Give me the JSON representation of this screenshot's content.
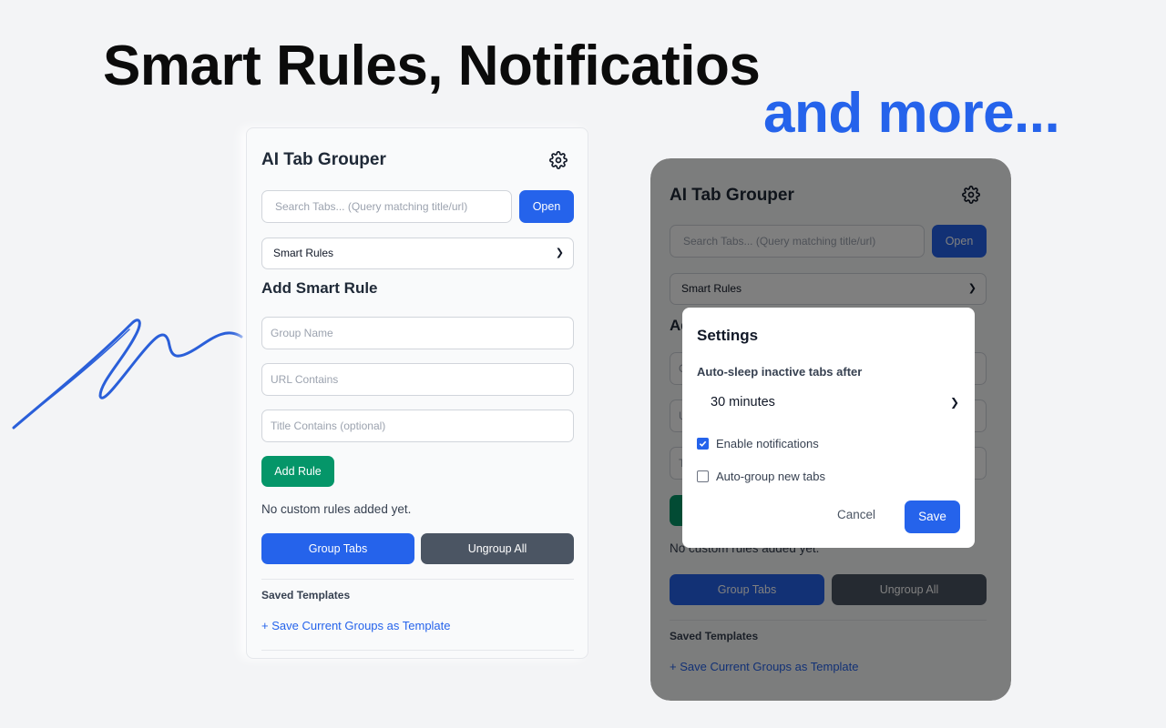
{
  "headline": "Smart Rules, Notificatios",
  "subheadline": "and more...",
  "popup": {
    "app_title": "AI Tab Grouper",
    "search_placeholder": "Search Tabs... (Query matching title/url)",
    "open_label": "Open",
    "mode_select": "Smart Rules",
    "add_rule_heading": "Add Smart Rule",
    "group_name_placeholder": "Group Name",
    "url_contains_placeholder": "URL Contains",
    "title_contains_placeholder": "Title Contains (optional)",
    "add_rule_label": "Add Rule",
    "empty_rules_text": "No custom rules added yet.",
    "group_tabs_label": "Group Tabs",
    "ungroup_all_label": "Ungroup All",
    "saved_templates_label": "Saved Templates",
    "save_template_link": "+ Save Current Groups as Template"
  },
  "settings_modal": {
    "title": "Settings",
    "auto_sleep_label": "Auto-sleep inactive tabs after",
    "auto_sleep_value": "30 minutes",
    "enable_notifications_label": "Enable notifications",
    "enable_notifications_checked": true,
    "auto_group_label": "Auto-group new tabs",
    "auto_group_checked": false,
    "cancel_label": "Cancel",
    "save_label": "Save"
  },
  "colors": {
    "accent": "#2563eb",
    "success": "#059669",
    "neutral_button": "#4b5563"
  }
}
